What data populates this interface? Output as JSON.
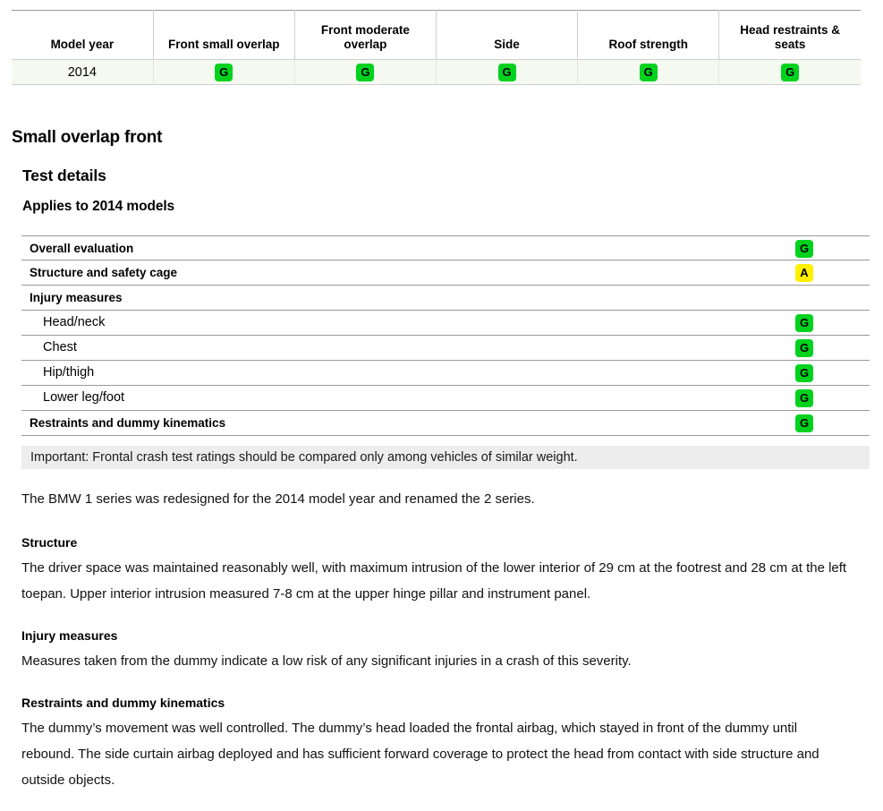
{
  "summary_table": {
    "columns": [
      "Model year",
      "Front small overlap",
      "Front moderate overlap",
      "Side",
      "Roof strength",
      "Head restraints & seats"
    ],
    "rows": [
      {
        "model_year": "2014",
        "ratings": [
          "G",
          "G",
          "G",
          "G",
          "G"
        ]
      }
    ]
  },
  "section": {
    "title": "Small overlap front",
    "subtitle": "Test details",
    "applies_to": "Applies to 2014 models"
  },
  "details": {
    "rows": [
      {
        "label": "Overall evaluation",
        "rating": "G",
        "indent": false
      },
      {
        "label": "Structure and safety cage",
        "rating": "A",
        "indent": false
      },
      {
        "label": "Injury measures",
        "rating": "",
        "indent": false
      },
      {
        "label": "Head/neck",
        "rating": "G",
        "indent": true
      },
      {
        "label": "Chest",
        "rating": "G",
        "indent": true
      },
      {
        "label": "Hip/thigh",
        "rating": "G",
        "indent": true
      },
      {
        "label": "Lower leg/foot",
        "rating": "G",
        "indent": true
      },
      {
        "label": "Restraints and dummy kinematics",
        "rating": "G",
        "indent": false
      }
    ]
  },
  "important_note": "Important: Frontal crash test ratings should be compared only among vehicles of similar weight.",
  "body": {
    "intro": "The BMW 1 series was redesigned for the 2014 model year and renamed the 2 series.",
    "blocks": [
      {
        "heading": "Structure",
        "text": "The driver space was maintained reasonably well, with maximum intrusion of the lower interior of 29 cm at the footrest and 28 cm at the left toepan. Upper interior intrusion measured 7-8 cm at the upper hinge pillar and instrument panel."
      },
      {
        "heading": "Injury measures",
        "text": "Measures taken from the dummy indicate a low risk of any significant injuries in a crash of this severity."
      },
      {
        "heading": "Restraints and dummy kinematics",
        "text": "The dummy’s movement was well controlled. The dummy’s head loaded the frontal airbag, which stayed in front of the dummy until rebound. The side curtain airbag deployed and has sufficient forward coverage to protect the head from contact with side structure and outside objects."
      }
    ]
  },
  "rating_colors": {
    "G": "#00d21e",
    "A": "#fff000",
    "M": "#ff9900",
    "P": "#ff0000"
  }
}
